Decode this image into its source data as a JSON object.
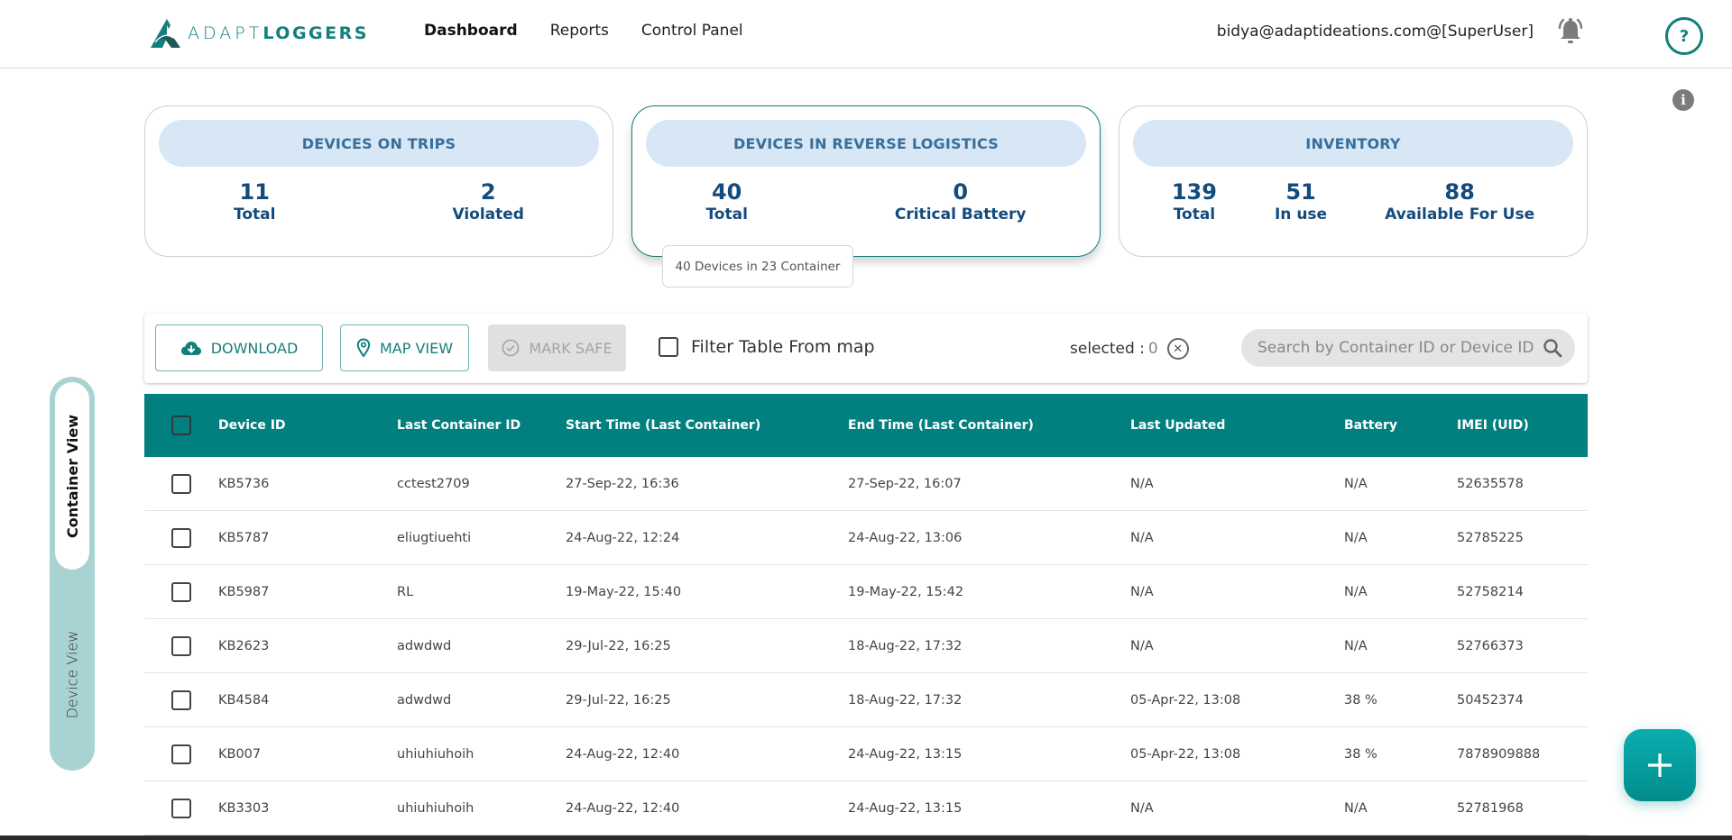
{
  "brand": {
    "name_light": "ADAPT",
    "name_bold": "LOGGERS",
    "color": "#137f7c"
  },
  "nav": {
    "items": [
      {
        "label": "Dashboard",
        "active": true
      },
      {
        "label": "Reports",
        "active": false
      },
      {
        "label": "Control Panel",
        "active": false
      }
    ]
  },
  "user": {
    "email": "bidya@adaptideations.com@[SuperUser]"
  },
  "header_icons": {
    "notifications": "bell-icon",
    "help": "?",
    "info": "i"
  },
  "cards": {
    "trips": {
      "title": "DEVICES ON TRIPS",
      "stats": [
        {
          "value": "11",
          "label": "Total"
        },
        {
          "value": "2",
          "label": "Violated"
        }
      ]
    },
    "reverse": {
      "title": "DEVICES IN REVERSE LOGISTICS",
      "stats": [
        {
          "value": "40",
          "label": "Total"
        },
        {
          "value": "0",
          "label": "Critical Battery"
        }
      ],
      "tooltip": "40 Devices in 23 Container"
    },
    "inventory": {
      "title": "INVENTORY",
      "stats": [
        {
          "value": "139",
          "label": "Total"
        },
        {
          "value": "51",
          "label": "In use"
        },
        {
          "value": "88",
          "label": "Available For Use"
        }
      ]
    }
  },
  "toolbar": {
    "download_label": "DOWNLOAD",
    "mapview_label": "MAP VIEW",
    "marksafe_label": "MARK SAFE",
    "filter_label": "Filter Table From map",
    "selected_label": "selected :",
    "selected_count": "0",
    "search_placeholder": "Search by Container ID or Device ID"
  },
  "view_toggle": {
    "active": "Container View",
    "inactive": "Device View"
  },
  "table": {
    "columns": [
      "Device ID",
      "Last Container ID",
      "Start Time (Last Container)",
      "End Time (Last Container)",
      "Last Updated",
      "Battery",
      "IMEI (UID)"
    ],
    "rows": [
      [
        "KB5736",
        "cctest2709",
        "27-Sep-22, 16:36",
        "27-Sep-22, 16:07",
        "N/A",
        "N/A",
        "52635578"
      ],
      [
        "KB5787",
        "eliugtiuehti",
        "24-Aug-22, 12:24",
        "24-Aug-22, 13:06",
        "N/A",
        "N/A",
        "52785225"
      ],
      [
        "KB5987",
        "RL",
        "19-May-22, 15:40",
        "19-May-22, 15:42",
        "N/A",
        "N/A",
        "52758214"
      ],
      [
        "KB2623",
        "adwdwd",
        "29-Jul-22, 16:25",
        "18-Aug-22, 17:32",
        "N/A",
        "N/A",
        "52766373"
      ],
      [
        "KB4584",
        "adwdwd",
        "29-Jul-22, 16:25",
        "18-Aug-22, 17:32",
        "05-Apr-22, 13:08",
        "38 %",
        "50452374"
      ],
      [
        "KB007",
        "uhiuhiuhoih",
        "24-Aug-22, 12:40",
        "24-Aug-22, 13:15",
        "05-Apr-22, 13:08",
        "38 %",
        "7878909888"
      ],
      [
        "KB3303",
        "uhiuhiuhoih",
        "24-Aug-22, 12:40",
        "24-Aug-22, 13:15",
        "N/A",
        "N/A",
        "52781968"
      ]
    ]
  },
  "colors": {
    "accent": "#02807f",
    "card_title_bg": "#d7e7f5",
    "stat_text": "#134b7d",
    "toggle_bg": "#a9d2d3"
  }
}
